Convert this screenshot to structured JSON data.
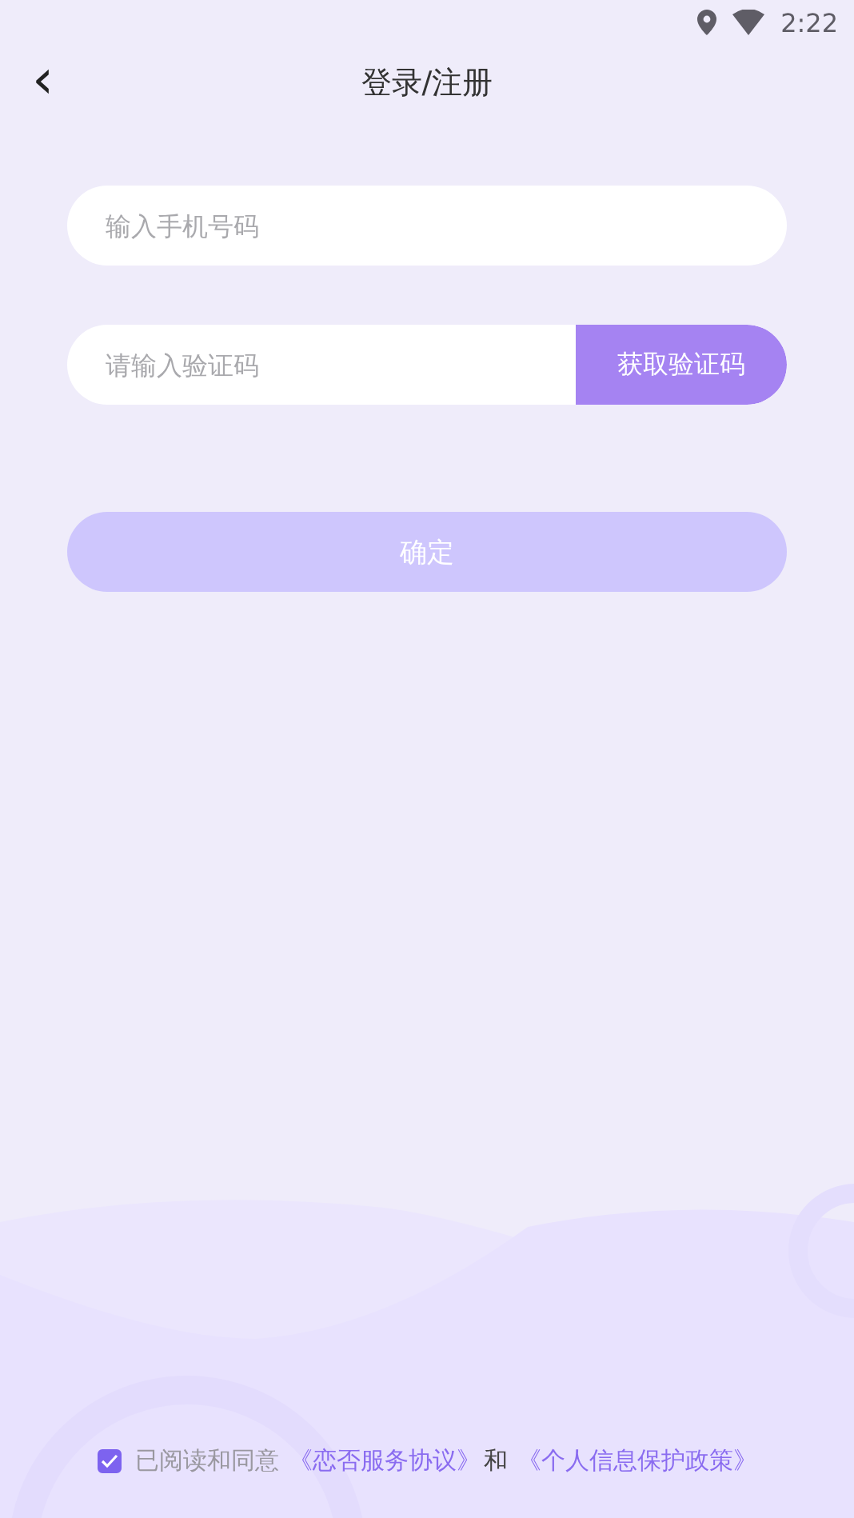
{
  "status_bar": {
    "time": "2:22"
  },
  "header": {
    "back_icon": "‹",
    "title": "登录/注册"
  },
  "form": {
    "phone": {
      "placeholder": "输入手机号码"
    },
    "code": {
      "placeholder": "请输入验证码"
    },
    "get_code_button": "获取验证码",
    "confirm_button": {
      "label": "确定",
      "disabled": true
    }
  },
  "agreement": {
    "checked": true,
    "prefix": "已阅读和同意",
    "links": [
      "《恋否服务协议》",
      "《个人信息保护政策》"
    ],
    "joiner": "和"
  }
}
